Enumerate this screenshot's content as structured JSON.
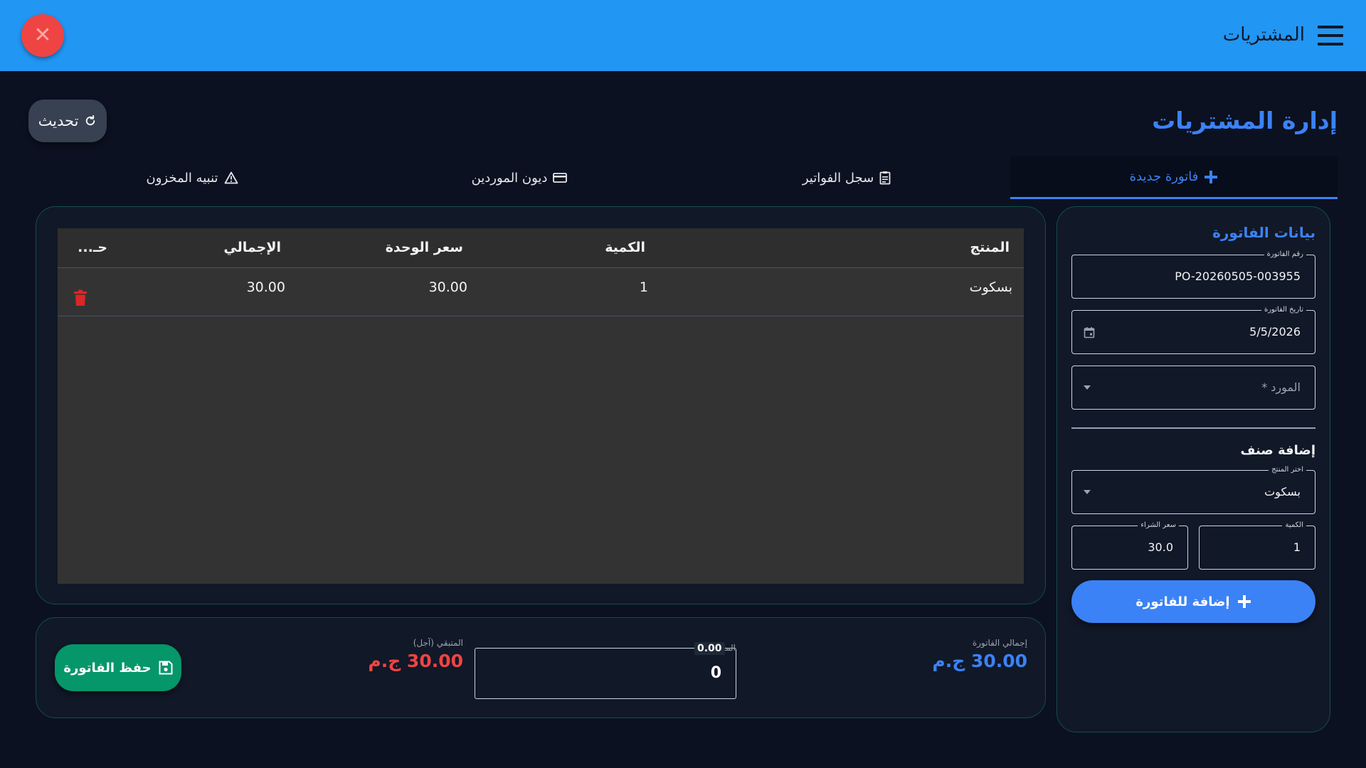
{
  "appbar": {
    "title": "المشتريات",
    "close_glyph": "✕",
    "menu_icon": "hamburger-menu-icon",
    "color": "#2196f3"
  },
  "page": {
    "title": "إدارة المشتريات",
    "refresh_label": "تحديث",
    "accent": "#3b82f6"
  },
  "tabs": [
    {
      "label": "فاتورة جديدة",
      "icon": "plus-icon",
      "active": true
    },
    {
      "label": "سجل الفواتير",
      "icon": "clipboard-icon",
      "active": false
    },
    {
      "label": "ديون الموردين",
      "icon": "credit-card-icon",
      "active": false
    },
    {
      "label": "تنبيه المخزون",
      "icon": "warning-icon",
      "active": false
    }
  ],
  "invoice_form": {
    "title": "بيانات الفاتورة",
    "invoice_number_label": "رقم الفاتورة",
    "invoice_number": "PO-20260505-003955",
    "invoice_date_label": "تاريخ الفاتورة",
    "invoice_date": "5/5/2026",
    "supplier_placeholder": "المورد *",
    "add_item_title": "إضافة صنف",
    "product_label": "اختر المنتج",
    "product_value": "بسكوت",
    "price_label": "سعر الشراء",
    "price_value": "30.0",
    "qty_label": "الكمية",
    "qty_value": "1",
    "add_button": "إضافة للفاتورة"
  },
  "table": {
    "headers": {
      "product": "المنتج",
      "qty": "الكمية",
      "unit_price": "سعر الوحدة",
      "total": "الإجمالي",
      "action": "حـ..."
    },
    "rows": [
      {
        "product": "بسكوت",
        "qty": "1",
        "unit_price": "30.00",
        "total": "30.00"
      }
    ]
  },
  "totals": {
    "invoice_total_label": "إجمالي الفاتورة",
    "invoice_total": "30.00 ج.م",
    "paid_label": "المدفوع",
    "paid_badge": "0.00",
    "paid_value": "0",
    "remaining_label": "المتبقي (آجل)",
    "remaining": "30.00 ج.م",
    "save_button": "حفظ الفاتورة",
    "total_color": "#3b82f6",
    "remaining_color": "#ef4444",
    "save_color": "#059669"
  }
}
